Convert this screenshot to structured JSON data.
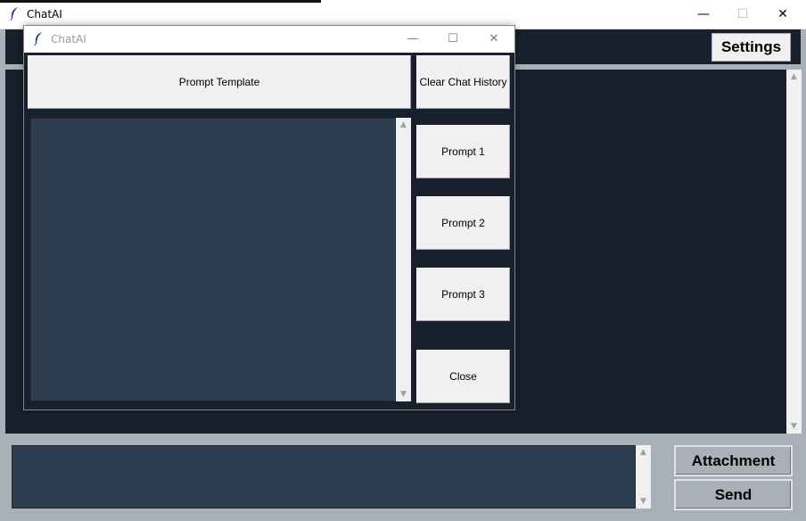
{
  "main_window": {
    "title": "ChatAI",
    "controls": {
      "minimize": "—",
      "maximize": "☐",
      "close": "✕"
    },
    "settings_label": "Settings",
    "attachment_label": "Attachment",
    "send_label": "Send"
  },
  "dialog": {
    "title": "ChatAI",
    "controls": {
      "minimize": "—",
      "maximize": "☐",
      "close": "✕"
    },
    "prompt_template_label": "Prompt Template",
    "clear_history_label": "Clear Chat History",
    "prompt1_label": "Prompt 1",
    "prompt2_label": "Prompt 2",
    "prompt3_label": "Prompt 3",
    "close_label": "Close"
  },
  "scroll_arrows": {
    "up": "▲",
    "down": "▼"
  },
  "colors": {
    "dark_bg": "#17202c",
    "text_area_bg": "#2d3e50",
    "frame_bg": "#a9b0b8",
    "button_bg": "#f0f0f0"
  },
  "icons": {
    "app_icon": "feather-icon"
  }
}
